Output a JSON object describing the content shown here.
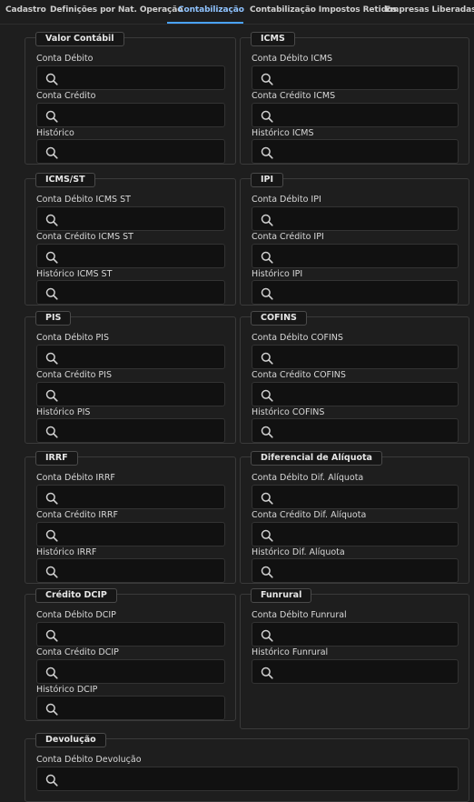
{
  "tabs": [
    {
      "label": "Cadastro"
    },
    {
      "label": "Definições por Nat. Operação"
    },
    {
      "label": "Contabilização"
    },
    {
      "label": "Contabilização Impostos Retidos"
    },
    {
      "label": "Empresas Liberadas"
    }
  ],
  "active_tab": "Contabilização",
  "panels": {
    "valor_contabil": {
      "title": "Valor Contábil",
      "fields": [
        "Conta Débito",
        "Conta Crédito",
        "Histórico"
      ]
    },
    "icms": {
      "title": "ICMS",
      "fields": [
        "Conta Débito ICMS",
        "Conta Crédito ICMS",
        "Histórico ICMS"
      ]
    },
    "icms_st": {
      "title": "ICMS/ST",
      "fields": [
        "Conta Débito ICMS ST",
        "Conta Crédito ICMS ST",
        "Histórico ICMS ST"
      ]
    },
    "ipi": {
      "title": "IPI",
      "fields": [
        "Conta Débito IPI",
        "Conta Crédito IPI",
        "Histórico IPI"
      ]
    },
    "pis": {
      "title": "PIS",
      "fields": [
        "Conta Débito PIS",
        "Conta Crédito PIS",
        "Histórico PIS"
      ]
    },
    "cofins": {
      "title": "COFINS",
      "fields": [
        "Conta Débito COFINS",
        "Conta Crédito COFINS",
        "Histórico COFINS"
      ]
    },
    "irrf": {
      "title": "IRRF",
      "fields": [
        "Conta Débito IRRF",
        "Conta Crédito IRRF",
        "Histórico IRRF"
      ]
    },
    "dif_aliquota": {
      "title": "Diferencial de Alíquota",
      "fields": [
        "Conta Débito Dif. Alíquota",
        "Conta Crédito Dif. Alíquota",
        "Histórico Dif. Alíquota"
      ]
    },
    "credito_dcip": {
      "title": "Crédito DCIP",
      "fields": [
        "Conta Débito DCIP",
        "Conta Crédito DCIP",
        "Histórico DCIP"
      ]
    },
    "funrural": {
      "title": "Funrural",
      "fields": [
        "Conta Débito Funrural",
        "Histórico Funrural"
      ]
    },
    "devolucao": {
      "title": "Devolução",
      "fields": [
        "Conta Débito Devolução"
      ]
    }
  },
  "icons": {
    "search": "search-icon"
  },
  "colors": {
    "accent": "#4aa3ff",
    "background": "#1e1e1e",
    "input_bg": "#111111"
  }
}
